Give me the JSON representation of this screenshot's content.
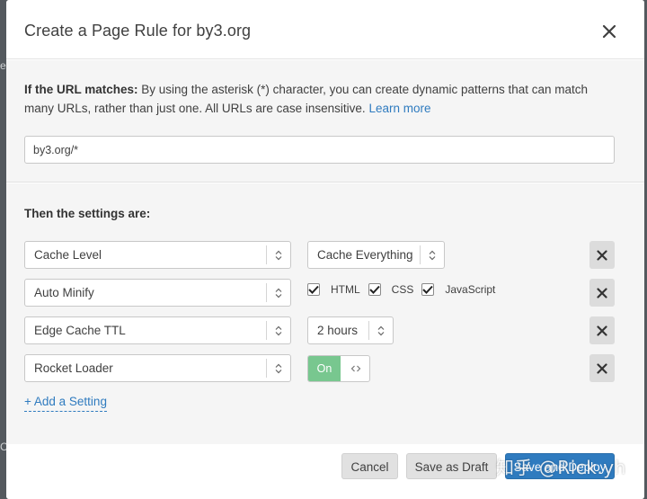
{
  "modal": {
    "title": "Create a Page Rule for by3.org",
    "close_icon": "close-icon"
  },
  "url_section": {
    "label_bold": "If the URL matches:",
    "description": " By using the asterisk (*) character, you can create dynamic patterns that can match many URLs, rather than just one. All URLs are case insensitive. ",
    "learn_more": "Learn more",
    "url_value": "by3.org/*"
  },
  "settings": {
    "heading": "Then the settings are:",
    "rows": [
      {
        "setting": "Cache Level",
        "value": "Cache Everything"
      },
      {
        "setting": "Auto Minify",
        "checks": [
          {
            "label": "HTML",
            "checked": true
          },
          {
            "label": "CSS",
            "checked": true
          },
          {
            "label": "JavaScript",
            "checked": true
          }
        ]
      },
      {
        "setting": "Edge Cache TTL",
        "value": "2 hours"
      },
      {
        "setting": "Rocket Loader",
        "toggle": "On"
      }
    ],
    "add_setting": "+ Add a Setting"
  },
  "footer": {
    "cancel": "Cancel",
    "save_draft": "Save as Draft",
    "deploy": "Save and Deploy"
  },
  "watermark": "知乎 @Rick.yh",
  "colors": {
    "accent": "#2f7bbf",
    "toggle_on": "#78c78f",
    "backdrop": "#54595e"
  }
}
